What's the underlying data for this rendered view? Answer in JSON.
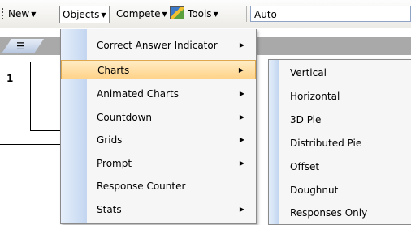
{
  "toolbar": {
    "new_label": "New",
    "objects_label": "Objects",
    "compete_label": "Compete",
    "tools_label": "Tools",
    "auto_value": "Auto"
  },
  "slide": {
    "number": "1"
  },
  "objects_menu": {
    "items": [
      {
        "label": "Correct Answer Indicator",
        "submenu": true
      },
      {
        "label": "Charts",
        "submenu": true
      },
      {
        "label": "Animated Charts",
        "submenu": true
      },
      {
        "label": "Countdown",
        "submenu": true
      },
      {
        "label": "Grids",
        "submenu": true
      },
      {
        "label": "Prompt",
        "submenu": true
      },
      {
        "label": "Response Counter",
        "submenu": false
      },
      {
        "label": "Stats",
        "submenu": true
      }
    ]
  },
  "charts_menu": {
    "items": [
      {
        "label": "Vertical"
      },
      {
        "label": "Horizontal"
      },
      {
        "label": "3D Pie"
      },
      {
        "label": "Distributed Pie"
      },
      {
        "label": "Offset"
      },
      {
        "label": "Doughnut"
      },
      {
        "label": "Responses Only"
      }
    ]
  },
  "icons": {
    "dropdown": "chevron-down-icon",
    "submenu": "chevron-right-icon",
    "tools": "tools-icon",
    "view": "slide-list-icon"
  }
}
